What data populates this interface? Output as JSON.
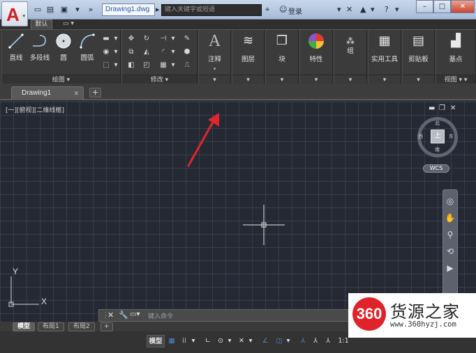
{
  "window": {
    "document_title": "Drawing1.dwg",
    "search_placeholder": "键入关键字或短语",
    "login_label": "登录"
  },
  "ribbon": {
    "active_tab": "默认",
    "draw_tools": [
      {
        "label": "直线",
        "icon": "line-icon"
      },
      {
        "label": "多段线",
        "icon": "polyline-icon"
      },
      {
        "label": "圆",
        "icon": "circle-icon"
      },
      {
        "label": "圆弧",
        "icon": "arc-icon"
      }
    ],
    "draw_panel_title": "绘图",
    "modify_panel_title": "修改",
    "panels": [
      {
        "label": "注释",
        "icon": "annotation-icon"
      },
      {
        "label": "图层",
        "icon": "layers-icon"
      },
      {
        "label": "块",
        "icon": "block-icon"
      },
      {
        "label": "特性",
        "icon": "properties-icon"
      },
      {
        "label": "组",
        "icon": "group-icon"
      },
      {
        "label": "实用工具",
        "icon": "calculator-icon"
      },
      {
        "label": "剪贴板",
        "icon": "clipboard-icon"
      },
      {
        "label": "基点",
        "icon": "basepoint-icon"
      }
    ],
    "view_panel_title": "视图"
  },
  "document_tab": {
    "label": "Drawing1"
  },
  "canvas": {
    "viewport_label": "[一][俯视][二维线框]",
    "viewcube": {
      "face": "上",
      "north": "北",
      "south": "南",
      "east": "东",
      "west": "西"
    },
    "wcs_label": "WCS",
    "ucs_x": "X",
    "ucs_y": "Y"
  },
  "command_line": {
    "placeholder": "键入命令"
  },
  "layout_tabs": [
    "模型",
    "布局1",
    "布局2"
  ],
  "status_bar": {
    "model_label": "模型",
    "scale": "1:1"
  },
  "watermark": {
    "logo_text": "360",
    "name": "货源之家",
    "url": "www.360hyzj.com"
  },
  "colors": {
    "annotation_arrow": "#e0262c",
    "canvas_bg": "#242933",
    "logo_red": "#e0232a"
  }
}
